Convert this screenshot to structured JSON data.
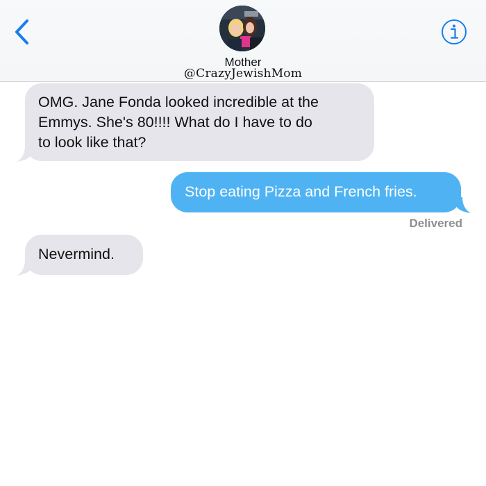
{
  "header": {
    "contact_name": "Mother",
    "contact_handle": "@CrazyJewishMom",
    "back_icon": "chevron-left-icon",
    "info_icon": "info-circle-icon",
    "accent_color": "#1a7cf0"
  },
  "messages": [
    {
      "direction": "incoming",
      "text": "OMG. Jane Fonda looked incredible at the\nEmmys. She's 80!!!! What do I have to do\nto look like that?"
    },
    {
      "direction": "outgoing",
      "text": "Stop eating Pizza and French fries."
    },
    {
      "direction": "incoming",
      "text": "Nevermind."
    }
  ],
  "status": {
    "delivered_label": "Delivered"
  },
  "colors": {
    "incoming_bubble": "#e6e5eb",
    "outgoing_bubble": "#4fb3f3",
    "status_text": "#8e8e93"
  }
}
